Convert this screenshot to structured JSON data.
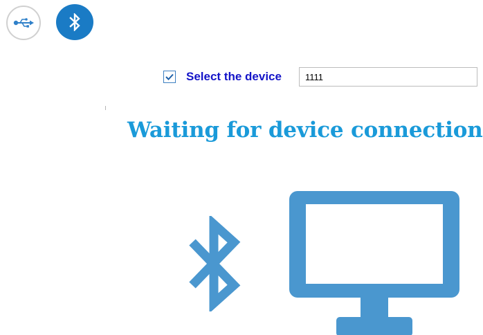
{
  "toolbar": {
    "usb_mode": {
      "icon": "usb-icon",
      "active": false
    },
    "bluetooth_mode": {
      "icon": "bluetooth-icon",
      "active": true
    }
  },
  "device_select": {
    "checked": true,
    "label": "Select the device",
    "input_value": "1111"
  },
  "status": {
    "message": "Waiting for device connection"
  },
  "illustration": {
    "left_icon": "bluetooth-icon",
    "right_icon": "monitor-icon"
  },
  "colors": {
    "accent": "#1a7bc5",
    "title": "#1a9ad9",
    "illustration": "#4a97cf",
    "label": "#1414c8"
  }
}
